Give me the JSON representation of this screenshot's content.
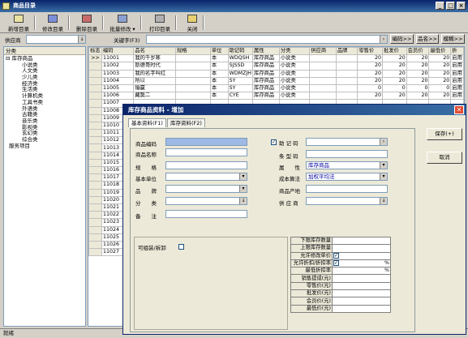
{
  "window": {
    "title": "商品目录"
  },
  "toolbar": {
    "new": "新增目录",
    "edit": "修改目录",
    "delete": "删除目录",
    "batch": "批量修改",
    "print": "打印目录",
    "close": "关闭"
  },
  "search": {
    "supplier_label": "供应商",
    "keyword_label": "关键字(F3)",
    "btn_code": "编码>>",
    "btn_name": "品名>>",
    "btn_fuzzy": "模糊>>"
  },
  "tree": {
    "header": "分类",
    "items": [
      "库存商品",
      "小说类",
      "人文类",
      "少儿类",
      "经济类",
      "生活类",
      "计算机类",
      "工具书类",
      "外语类",
      "古籍类",
      "音乐类",
      "影视类",
      "玄幻类",
      "综合类",
      "服务项目"
    ]
  },
  "grid": {
    "columns": [
      "标志",
      "编码",
      "品名",
      "规格",
      "单位",
      "助记码",
      "属性",
      "分类",
      "供应商",
      "品牌",
      "零售价",
      "批发价",
      "会员价",
      "最低价",
      "折"
    ],
    "rows": [
      {
        "mk": ">>",
        "code": "11001",
        "name": "我的千岁寒",
        "unit": "本",
        "mnem": "WDQSH",
        "attr": "库存商品",
        "cat": "小说类",
        "retail": "20",
        "whole": "20",
        "member": "20",
        "min": "20",
        "disc": "启用"
      },
      {
        "mk": "",
        "code": "11002",
        "name": "斯德哥时代",
        "unit": "本",
        "mnem": "SJSSD",
        "attr": "库存商品",
        "cat": "小说类",
        "retail": "20",
        "whole": "20",
        "member": "20",
        "min": "20",
        "disc": "启用"
      },
      {
        "mk": "",
        "code": "11003",
        "name": "我的名字叫红",
        "unit": "本",
        "mnem": "WDMZJH",
        "attr": "库存商品",
        "cat": "小说类",
        "retail": "20",
        "whole": "20",
        "member": "20",
        "min": "20",
        "disc": "启用"
      },
      {
        "mk": "",
        "code": "11004",
        "name": "所以",
        "unit": "本",
        "mnem": "SY",
        "attr": "库存商品",
        "cat": "小说类",
        "retail": "20",
        "whole": "20",
        "member": "20",
        "min": "20",
        "disc": "启用"
      },
      {
        "mk": "",
        "code": "11005",
        "name": "输赢",
        "unit": "本",
        "mnem": "SY",
        "attr": "库存商品",
        "cat": "小说类",
        "retail": "0",
        "whole": "0",
        "member": "0",
        "min": "0",
        "disc": "启用"
      },
      {
        "mk": "",
        "code": "11006",
        "name": "藏獒二",
        "unit": "本",
        "mnem": "CYE",
        "attr": "库存商品",
        "cat": "小说类",
        "retail": "20",
        "whole": "20",
        "member": "20",
        "min": "20",
        "disc": "启用"
      },
      {
        "mk": "",
        "code": "11007"
      },
      {
        "mk": "",
        "code": "11008"
      },
      {
        "mk": "",
        "code": "11009"
      },
      {
        "mk": "",
        "code": "11010"
      },
      {
        "mk": "",
        "code": "11011"
      },
      {
        "mk": "",
        "code": "11012"
      },
      {
        "mk": "",
        "code": "11013"
      },
      {
        "mk": "",
        "code": "11014"
      },
      {
        "mk": "",
        "code": "11015"
      },
      {
        "mk": "",
        "code": "11016"
      },
      {
        "mk": "",
        "code": "11017"
      },
      {
        "mk": "",
        "code": "11018"
      },
      {
        "mk": "",
        "code": "11019"
      },
      {
        "mk": "",
        "code": "11020"
      },
      {
        "mk": "",
        "code": "11021"
      },
      {
        "mk": "",
        "code": "11022"
      },
      {
        "mk": "",
        "code": "11023"
      },
      {
        "mk": "",
        "code": "11024"
      },
      {
        "mk": "",
        "code": "11025"
      },
      {
        "mk": "",
        "code": "11026"
      },
      {
        "mk": "",
        "code": "11027"
      }
    ]
  },
  "status": "就绪",
  "dialog": {
    "title": "库存商品资料 - 增加",
    "tab_basic": "基本资料(F1)",
    "tab_stock": "库存资料(F2)",
    "save": "保存(+)",
    "cancel": "取消",
    "labels": {
      "code": "商品编码",
      "name": "商品名称",
      "spec": "规　　格",
      "unit": "基本单位",
      "brand": "品　　牌",
      "cat": "分　　类",
      "note": "备　　注",
      "mnem": "助 记 码",
      "barcode": "条 型 码",
      "attr": "属　　性",
      "cost": "成本算法",
      "origin": "商品产地",
      "supplier": "供 应 商",
      "combo": "可组装/拆卸"
    },
    "values": {
      "attr": "库存商品",
      "cost": "加权平均法"
    },
    "right_table": [
      "下限库存数量",
      "上限库存数量",
      "允许修改单价",
      "允许折扣/折扣率",
      "最低折扣率",
      "销售提成(元)",
      "零售价(元)",
      "批发价(元)",
      "会员价(元)",
      "最低价(元)"
    ],
    "pct": "%"
  }
}
